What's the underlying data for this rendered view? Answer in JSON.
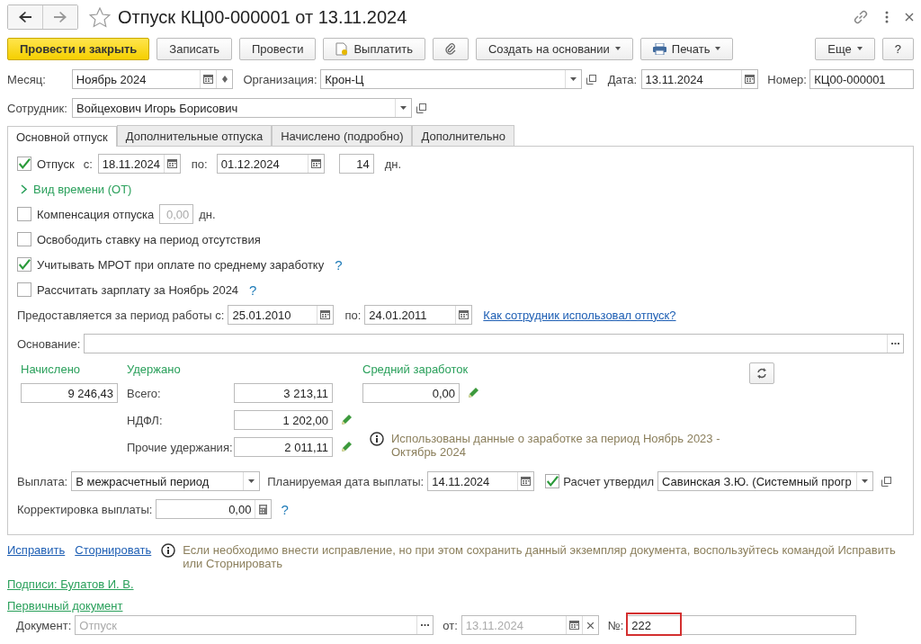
{
  "window": {
    "title": "Отпуск КЦ00-000001 от 13.11.2024"
  },
  "toolbar": {
    "left": [
      {
        "label": "Провести и закрыть",
        "kind": "primary"
      },
      {
        "label": "Записать",
        "kind": "plain"
      },
      {
        "label": "Провести",
        "kind": "plain"
      },
      {
        "label": "Выплатить",
        "kind": "pay"
      },
      {
        "kind": "attach"
      },
      {
        "label": "Создать на основании",
        "kind": "menu"
      },
      {
        "label": "Печать",
        "kind": "print"
      }
    ],
    "right": [
      {
        "label": "Еще",
        "kind": "menu"
      },
      {
        "label": "?",
        "kind": "plain"
      }
    ]
  },
  "header": {
    "month": {
      "label": "Месяц:",
      "value": "Ноябрь 2024"
    },
    "organization": {
      "label": "Организация:",
      "value": "Крон-Ц"
    },
    "date": {
      "label": "Дата:",
      "value": "13.11.2024"
    },
    "number": {
      "label": "Номер:",
      "value": "КЦ00-000001"
    },
    "employee": {
      "label": "Сотрудник:",
      "value": "Войцехович Игорь Борисович"
    }
  },
  "tabs": [
    {
      "label": "Основной отпуск",
      "selected": true
    },
    {
      "label": "Дополнительные отпуска",
      "selected": false
    },
    {
      "label": "Начислено (подробно)",
      "selected": false
    },
    {
      "label": "Дополнительно",
      "selected": false
    }
  ],
  "vacation": {
    "checked": true,
    "label": "Отпуск",
    "from_label": "с:",
    "from": "18.11.2024",
    "to_label": "по:",
    "to": "01.12.2024",
    "days": "14",
    "unit": "дн."
  },
  "time_kind": {
    "label": "Вид времени (ОТ)",
    "expanded": false
  },
  "options": [
    {
      "kind": "amount",
      "label": "Компенсация отпуска",
      "checked": false,
      "value": "0,00",
      "disabled": true,
      "unit": "дн."
    },
    {
      "kind": "plain",
      "label": "Освободить ставку на период отсутствия",
      "checked": false
    },
    {
      "kind": "help",
      "label": "Учитывать МРОТ при оплате по среднему заработку",
      "checked": true,
      "help": "?"
    },
    {
      "kind": "help",
      "label": "Рассчитать зарплату за Ноябрь 2024",
      "checked": false,
      "help": "?"
    }
  ],
  "period": {
    "label": "Предоставляется за период работы с:",
    "from": "25.01.2010",
    "to_label": "по:",
    "to": "24.01.2011",
    "link": "Как сотрудник использовал отпуск?"
  },
  "basis": {
    "label": "Основание:"
  },
  "accrued": {
    "label": "Начислено",
    "value": "9 246,43"
  },
  "withheld": {
    "label": "Удержано",
    "rows": [
      {
        "label": "Всего:",
        "value": "3 213,11",
        "editable": false
      },
      {
        "label": "НДФЛ:",
        "value": "1 202,00",
        "editable": true
      },
      {
        "label": "Прочие удержания:",
        "value": "2 011,11",
        "editable": true
      }
    ]
  },
  "average": {
    "label": "Средний заработок",
    "value": "0,00",
    "editable": true
  },
  "info": "Использованы данные о заработке за период Ноябрь 2023 - Октябрь 2024",
  "payment": {
    "label": "Выплата:",
    "value": "В межрасчетный период",
    "planned_label": "Планируемая дата выплаты:",
    "planned_date": "14.11.2024",
    "approved": {
      "checked": true,
      "label": "Расчет утвердил",
      "value": "Савинская З.Ю. (Системный прогр"
    }
  },
  "correction": {
    "label": "Корректировка выплаты:",
    "value": "0,00",
    "help": "?"
  },
  "footer": {
    "links": [
      "Исправить",
      "Сторнировать"
    ],
    "note": "Если необходимо внести исправление, но при этом сохранить данный экземпляр документа, воспользуйтесь командой Исправить или Сторнировать",
    "signatures": "Подписи: Булатов И. В.",
    "primary": "Первичный документ",
    "document": {
      "label": "Документ:",
      "value": "Отпуск",
      "disabled": true,
      "from_label": "от:",
      "date": "13.11.2024",
      "number_label": "№:",
      "number": "222",
      "highlighted": true
    }
  }
}
